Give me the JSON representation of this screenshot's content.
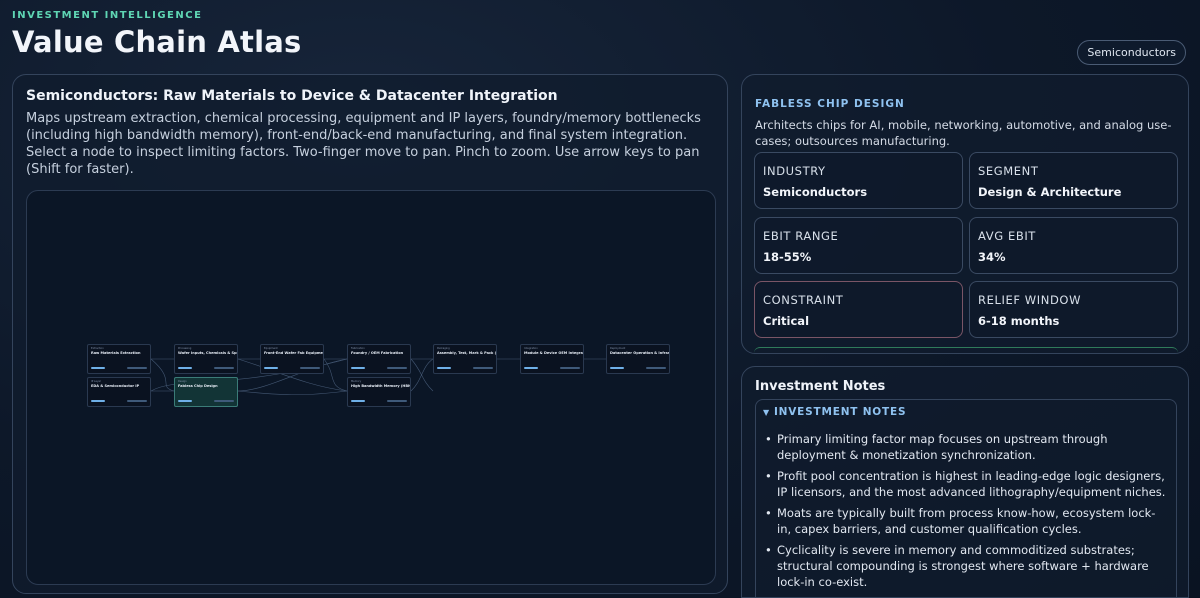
{
  "header": {
    "eyebrow": "INVESTMENT INTELLIGENCE",
    "title": "Value Chain Atlas",
    "badge": "Semiconductors"
  },
  "main": {
    "title": "Semiconductors: Raw Materials to Device & Datacenter Integration",
    "description": "Maps upstream extraction, chemical processing, equipment and IP layers, foundry/memory bottlenecks (including high bandwidth memory), front-end/back-end manufacturing, and final system integration. Select a node to inspect limiting factors. Two-finger move to pan. Pinch to zoom. Use arrow keys to pan (Shift for faster).",
    "nodes": [
      {
        "label": "Extraction",
        "title": "Raw Materials Extraction"
      },
      {
        "label": "Processing",
        "title": "Wafer Inputs, Chemicals & Specialty Gases"
      },
      {
        "label": "Equipment",
        "title": "Front-End Wafer Fab Equipment"
      },
      {
        "label": "Fabrication",
        "title": "Foundry / OEM Fabrication"
      },
      {
        "label": "Packaging",
        "title": "Assembly, Test, Mark & Pack (OSAT)"
      },
      {
        "label": "Integration",
        "title": "Module & Device OEM Integration"
      },
      {
        "label": "Deployment",
        "title": "Datacenter Operation & Infrastructure"
      },
      {
        "label": "IP Layer",
        "title": "EDA & Semiconductor IP"
      },
      {
        "label": "Design",
        "title": "Fabless Chip Design"
      },
      {
        "label": "Memory",
        "title": "High Bandwidth Memory (HBM) Design & Fabrication"
      }
    ]
  },
  "detail": {
    "eyebrow": "FABLESS CHIP DESIGN",
    "description": "Architects chips for AI, mobile, networking, automotive, and analog use-cases; outsources manufacturing.",
    "stats": [
      {
        "label": "INDUSTRY",
        "value": "Semiconductors"
      },
      {
        "label": "SEGMENT",
        "value": "Design & Architecture"
      },
      {
        "label": "EBIT RANGE",
        "value": "18-55%"
      },
      {
        "label": "AVG EBIT",
        "value": "34%"
      },
      {
        "label": "CONSTRAINT",
        "value": "Critical"
      },
      {
        "label": "RELIEF WINDOW",
        "value": "6-18 months"
      }
    ]
  },
  "notes": {
    "title": "Investment Notes",
    "sub_title": "INVESTMENT NOTES",
    "caret": "▼",
    "bullet": "•",
    "items": [
      "Primary limiting factor map focuses on upstream through deployment & monetization synchronization.",
      "Profit pool concentration is highest in leading-edge logic designers, IP licensors, and the most advanced lithography/equipment niches.",
      "Moats are typically built from process know-how, ecosystem lock-in, capex barriers, and customer qualification cycles.",
      "Cyclicality is severe in memory and commoditized substrates; structural compounding is strongest where software + hardware lock-in co-exist."
    ]
  },
  "colors": {
    "accent_green": "#5fd6b4",
    "accent_blue": "#8fc2f0",
    "constraint_border": "#7a5566"
  }
}
